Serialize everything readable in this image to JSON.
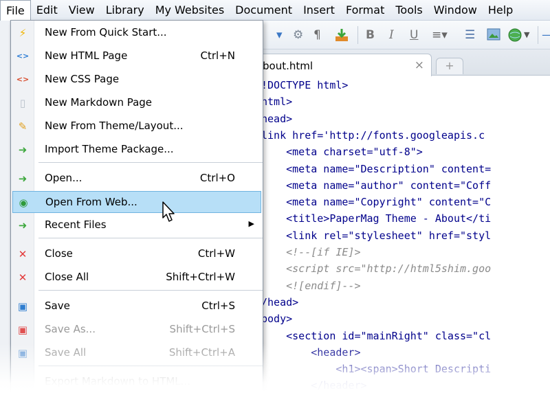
{
  "menubar": {
    "items": [
      "File",
      "Edit",
      "View",
      "Library",
      "My Websites",
      "Document",
      "Insert",
      "Format",
      "Tools",
      "Window",
      "Help"
    ],
    "active": "File"
  },
  "toolbar": {
    "icons": [
      "image-dropdown-icon",
      "preview-icon",
      "paragraph-icon",
      "publish-icon",
      "bold-icon",
      "italic-icon",
      "underline-icon",
      "align-icon",
      "list-icon",
      "image-icon",
      "web-icon",
      "more-icon"
    ]
  },
  "tab": {
    "filename": "bout.html",
    "close_glyph": "×",
    "new_glyph": "+"
  },
  "file_menu": {
    "items": [
      {
        "label": "New From Quick Start...",
        "shortcut": "",
        "icon": "quick-start-icon",
        "glyph": "⚡",
        "color": "#f0b400"
      },
      {
        "label": "New HTML Page",
        "shortcut": "Ctrl+N",
        "icon": "html-page-icon",
        "glyph": "<>",
        "color": "#2a7bd4"
      },
      {
        "label": "New CSS Page",
        "shortcut": "",
        "icon": "css-page-icon",
        "glyph": "<>",
        "color": "#d84a2a"
      },
      {
        "label": "New Markdown Page",
        "shortcut": "",
        "icon": "markdown-page-icon",
        "glyph": "▯",
        "color": "#b8c0ca"
      },
      {
        "label": "New From Theme/Layout...",
        "shortcut": "",
        "icon": "theme-layout-icon",
        "glyph": "✎",
        "color": "#e0a020"
      },
      {
        "label": "Import Theme Package...",
        "shortcut": "",
        "icon": "import-theme-icon",
        "glyph": "➜",
        "color": "#3ea83e"
      },
      {
        "label": "Open...",
        "shortcut": "Ctrl+O",
        "icon": "open-folder-icon",
        "glyph": "➜",
        "color": "#3ea83e"
      },
      {
        "label": "Open From Web...",
        "shortcut": "",
        "icon": "globe-icon",
        "glyph": "◉",
        "color": "#2e9a3a"
      },
      {
        "label": "Recent Files",
        "shortcut": "",
        "icon": "recent-files-icon",
        "glyph": "➜",
        "color": "#3ea83e"
      },
      {
        "label": "Close",
        "shortcut": "Ctrl+W",
        "icon": "close-icon",
        "glyph": "✕",
        "color": "#e23a3a"
      },
      {
        "label": "Close All",
        "shortcut": "Shift+Ctrl+W",
        "icon": "close-all-icon",
        "glyph": "✕",
        "color": "#e23a3a"
      },
      {
        "label": "Save",
        "shortcut": "Ctrl+S",
        "icon": "save-icon",
        "glyph": "▣",
        "color": "#2f7ed0"
      },
      {
        "label": "Save As...",
        "shortcut": "Shift+Ctrl+S",
        "icon": "save-as-icon",
        "glyph": "▣",
        "color": "#e05050"
      },
      {
        "label": "Save All",
        "shortcut": "Shift+Ctrl+A",
        "icon": "save-all-icon",
        "glyph": "▣",
        "color": "#6fa0d8"
      },
      {
        "label": "Export Markdown to HTML...",
        "shortcut": "",
        "icon": "export-icon",
        "glyph": "",
        "color": "#cccccc"
      }
    ]
  },
  "code": {
    "lines": [
      "!DOCTYPE html>",
      "html>",
      "head>",
      "link href='http://fonts.googleapis.c",
      "    <meta charset=\"utf-8\">",
      "    <meta name=\"Description\" content=",
      "    <meta name=\"author\" content=\"Coff",
      "    <meta name=\"Copyright\" content=\"C",
      "    <title>PaperMag Theme - About</ti",
      "    <link rel=\"stylesheet\" href=\"styl",
      "    <!--[if IE]>",
      "    <script src=\"http://html5shim.goo",
      "    <![endif]-->",
      "/head>",
      "body>",
      "    <section id=\"mainRight\" class=\"cl",
      "        <header>",
      "            <h1><span>Short Descripti",
      "        </header>"
    ]
  }
}
